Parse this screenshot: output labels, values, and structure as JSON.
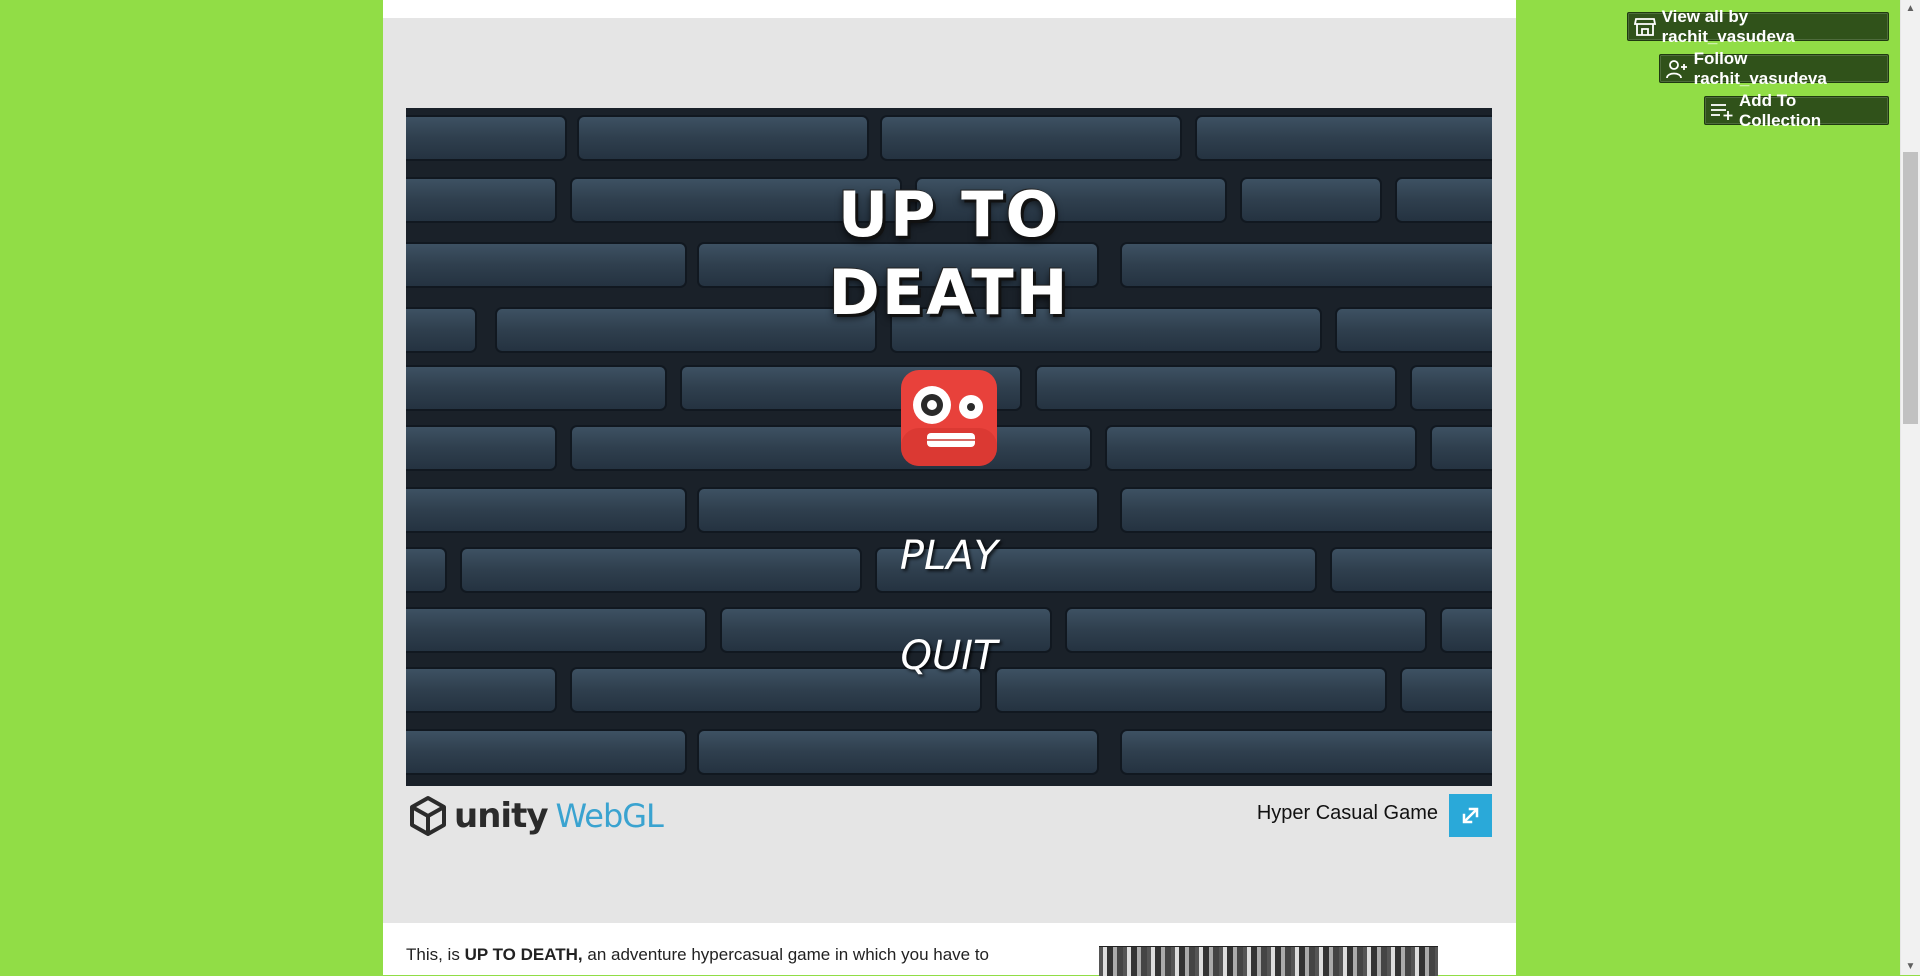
{
  "header_buttons": {
    "view_all": "View all by rachit_vasudeva",
    "follow": "Follow rachit_vasudeva",
    "add_collection": "Add To Collection"
  },
  "game": {
    "title": "UP TO\nDEATH",
    "menu": {
      "play": "PLAY",
      "quit": "QUIT"
    }
  },
  "player_footer": {
    "engine_name": "unity",
    "engine_platform": "WebGL",
    "game_name": "Hyper Casual Game",
    "fullscreen_icon": "fullscreen-icon"
  },
  "description": {
    "prefix": "This, is ",
    "bold": "UP TO DEATH,",
    "suffix": " an adventure hypercasual game in which you have to"
  },
  "colors": {
    "page_background": "#91dd46",
    "button_background": "#30521a",
    "fullscreen_button": "#2aa9d9",
    "webgl_text": "#3aa3d0",
    "mascot_red": "#e8413b"
  },
  "icons": {
    "view_all": "store-icon",
    "follow": "add-user-icon",
    "add_collection": "add-to-list-icon"
  }
}
